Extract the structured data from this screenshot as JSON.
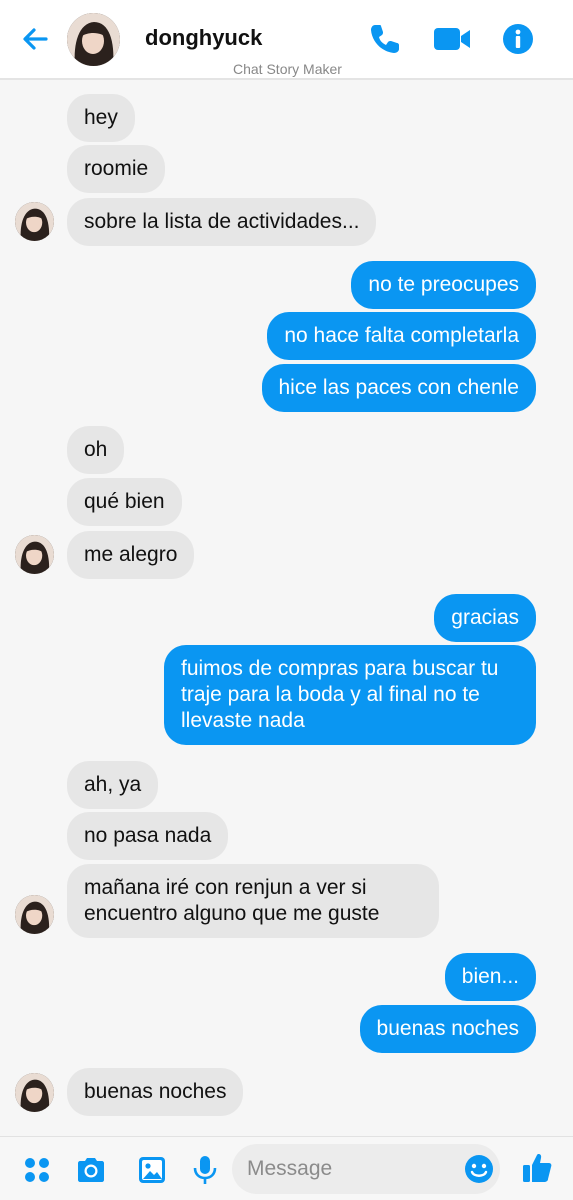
{
  "header": {
    "contact_name": "donghyuck",
    "watermark": "Chat Story Maker"
  },
  "colors": {
    "accent": "#0a96f2",
    "incoming_bubble": "#e6e6e6",
    "background": "#f6f6f6"
  },
  "messages": [
    {
      "side": "in",
      "text": "hey"
    },
    {
      "side": "in",
      "text": "roomie"
    },
    {
      "side": "in",
      "text": "sobre la lista de actividades..."
    },
    {
      "side": "out",
      "text": "no te preocupes"
    },
    {
      "side": "out",
      "text": "no hace falta completarla"
    },
    {
      "side": "out",
      "text": "hice las paces con chenle"
    },
    {
      "side": "in",
      "text": "oh"
    },
    {
      "side": "in",
      "text": "qué bien"
    },
    {
      "side": "in",
      "text": "me alegro"
    },
    {
      "side": "out",
      "text": "gracias"
    },
    {
      "side": "out",
      "text": "fuimos de compras para buscar tu traje para la boda y al final no te llevaste nada"
    },
    {
      "side": "in",
      "text": "ah, ya"
    },
    {
      "side": "in",
      "text": "no pasa nada"
    },
    {
      "side": "in",
      "text": "mañana iré con renjun a ver si encuentro alguno que me guste"
    },
    {
      "side": "out",
      "text": "bien..."
    },
    {
      "side": "out",
      "text": "buenas noches"
    },
    {
      "side": "in",
      "text": "buenas noches"
    }
  ],
  "composer": {
    "placeholder": "Message"
  },
  "icons": {
    "back": "arrow-left-icon",
    "call": "phone-icon",
    "video": "video-camera-icon",
    "info": "info-icon",
    "apps": "four-dots-icon",
    "camera": "camera-icon",
    "gallery": "image-icon",
    "mic": "microphone-icon",
    "emoji": "smiley-icon",
    "like": "thumbs-up-icon"
  }
}
